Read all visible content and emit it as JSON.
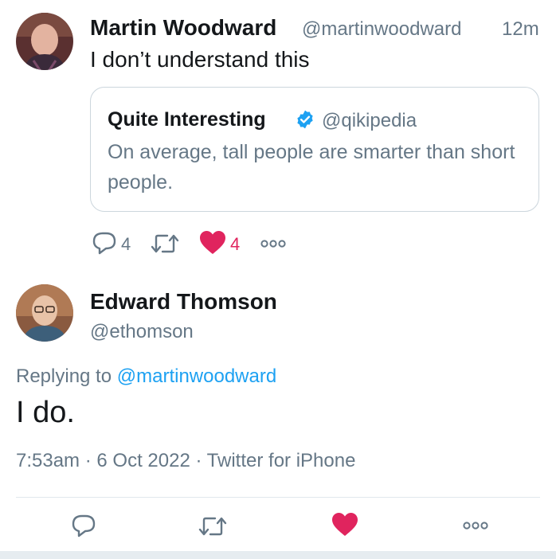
{
  "tweet": {
    "author_name": "Martin Woodward",
    "author_handle": "@martinwoodward",
    "time": "12m",
    "text": "I don’t understand this",
    "reply_count": "4",
    "like_count": "4",
    "quoted": {
      "author_name": "Quite Interesting",
      "author_handle": "@qikipedia",
      "verified_icon": "verified-badge-icon",
      "text": "On average, tall people are smarter than short people."
    }
  },
  "reply": {
    "author_name": "Edward Thomson",
    "author_handle": "@ethomson",
    "replying_prefix": "Replying to ",
    "replying_handle": "@martinwoodward",
    "text": "I do.",
    "meta": "7:53am · 6 Oct 2022 · Twitter for iPhone"
  },
  "colors": {
    "text_primary": "#14171a",
    "text_secondary": "#657786",
    "link": "#1da1f2",
    "like": "#e0245e",
    "border": "#ccd6dd"
  },
  "icons": {
    "reply": "speech-bubble-icon",
    "retweet": "retweet-arrows-icon",
    "like": "heart-icon",
    "more": "ellipsis-icon"
  }
}
